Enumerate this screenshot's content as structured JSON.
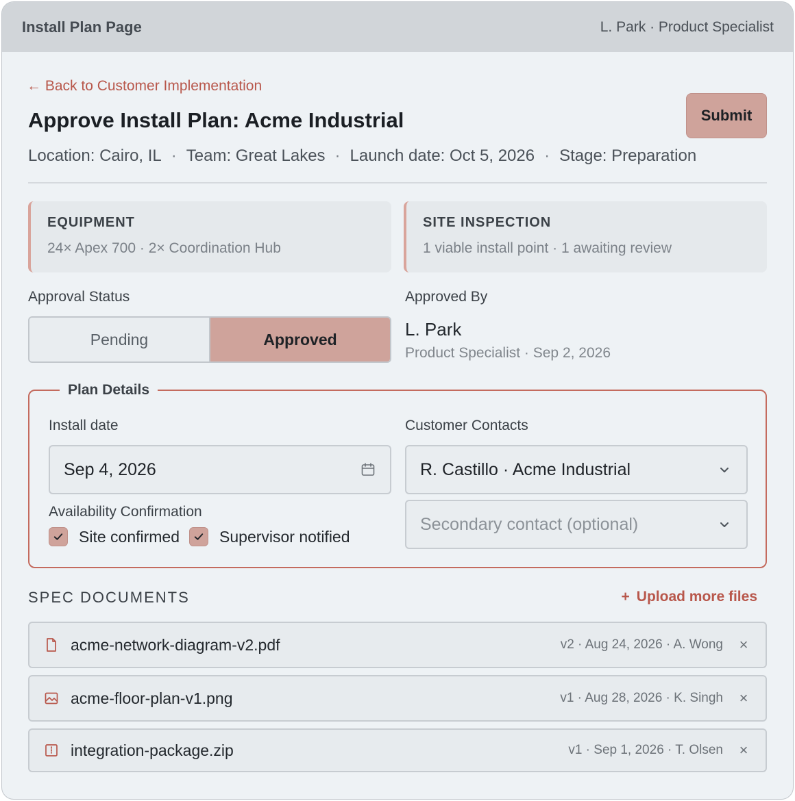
{
  "titlebar": {
    "title": "Install Plan Page",
    "user": "L. Park · Product Specialist"
  },
  "header": {
    "back_link": "← Back to Customer Implementation",
    "title": "Approve Install Plan: Acme Industrial",
    "submit_label": "Submit",
    "meta": {
      "location": "Location: Cairo, IL",
      "team": "Team: Great Lakes",
      "launch": "Launch date: Oct 5, 2026",
      "stage": "Stage: Preparation",
      "separator": "·"
    }
  },
  "cards": {
    "equipment": {
      "label": "EQUIPMENT",
      "value": "24× Apex 700 · 2× Coordination Hub"
    },
    "inspection": {
      "label": "SITE INSPECTION",
      "value": "1 viable install point · 1 awaiting review"
    }
  },
  "approval": {
    "label": "Approval Status",
    "options": [
      "Pending",
      "Approved"
    ],
    "selected": "Approved"
  },
  "approved_by": {
    "label": "Approved By",
    "name": "L. Park",
    "detail": "Product Specialist · Sep 2, 2026"
  },
  "plan": {
    "legend": "Plan Details",
    "install_date_label": "Install date",
    "install_date": "Sep 4, 2026",
    "contacts_label": "Customer Contacts",
    "primary_contact": "R. Castillo · Acme Industrial",
    "secondary_placeholder": "Secondary contact (optional)",
    "availability_label": "Availability Confirmation",
    "checks": [
      {
        "label": "Site confirmed",
        "checked": true
      },
      {
        "label": "Supervisor notified",
        "checked": true
      }
    ]
  },
  "spec": {
    "title": "SPEC DOCUMENTS",
    "upload_label": "Upload more files",
    "files": [
      {
        "name": "acme-network-diagram-v2.pdf",
        "meta": "v2 · Aug 24, 2026 · A. Wong",
        "icon": "document-icon"
      },
      {
        "name": "acme-floor-plan-v1.png",
        "meta": "v1 · Aug 28, 2026 · K. Singh",
        "icon": "image-icon"
      },
      {
        "name": "integration-package.zip",
        "meta": "v1 · Sep 1, 2026 · T. Olsen",
        "icon": "archive-icon"
      }
    ]
  },
  "colors": {
    "accent": "#b8574b",
    "accent_fill": "#cfa39b",
    "border_accent": "#c46b5e"
  }
}
